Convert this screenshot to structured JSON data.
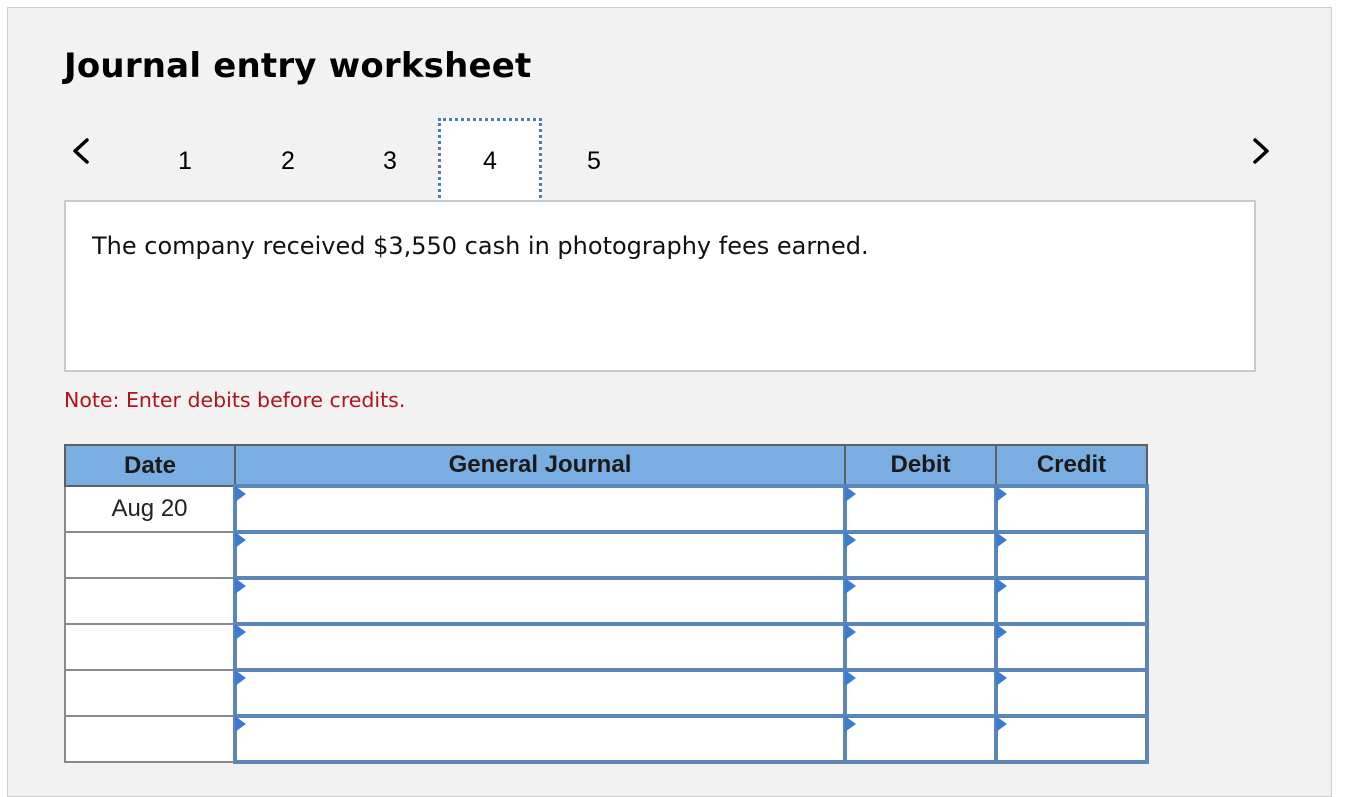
{
  "title": "Journal entry worksheet",
  "tabs": [
    {
      "label": "1",
      "active": false
    },
    {
      "label": "2",
      "active": false
    },
    {
      "label": "3",
      "active": false
    },
    {
      "label": "4",
      "active": true
    },
    {
      "label": "5",
      "active": false
    }
  ],
  "icons": {
    "prev": "chevron-left-icon",
    "next": "chevron-right-icon",
    "cell_marker": "dropdown-triangle-icon"
  },
  "description": "The company received $3,550 cash in photography fees earned.",
  "note": "Note: Enter debits before credits.",
  "table": {
    "headers": {
      "date": "Date",
      "journal": "General Journal",
      "debit": "Debit",
      "credit": "Credit"
    },
    "rows": [
      {
        "date": "Aug 20",
        "journal": "",
        "debit": "",
        "credit": ""
      },
      {
        "date": "",
        "journal": "",
        "debit": "",
        "credit": ""
      },
      {
        "date": "",
        "journal": "",
        "debit": "",
        "credit": ""
      },
      {
        "date": "",
        "journal": "",
        "debit": "",
        "credit": ""
      },
      {
        "date": "",
        "journal": "",
        "debit": "",
        "credit": ""
      },
      {
        "date": "",
        "journal": "",
        "debit": "",
        "credit": ""
      }
    ]
  },
  "colors": {
    "header_bg": "#7aaee3",
    "note": "#b0131c",
    "active_tab_border": "#4a78c2",
    "marker": "#3c7bd3"
  }
}
